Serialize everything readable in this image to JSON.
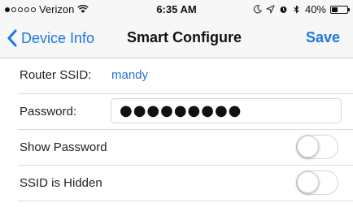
{
  "status_bar": {
    "carrier": "Verizon",
    "time": "6:35 AM",
    "battery_percent": "40%",
    "battery_level": 0.4,
    "icons": [
      "signal-dots",
      "wifi-icon",
      "moon-icon",
      "location-icon",
      "alarm-icon",
      "bluetooth-icon",
      "battery-icon"
    ]
  },
  "nav": {
    "back_label": "Device Info",
    "title": "Smart Configure",
    "save_label": "Save"
  },
  "form": {
    "router_ssid_label": "Router SSID:",
    "router_ssid_value": "mandy",
    "password_label": "Password:",
    "password_value": "●●●●●●●●●",
    "show_password_label": "Show Password",
    "show_password_on": false,
    "ssid_hidden_label": "SSID is Hidden",
    "ssid_hidden_on": false
  },
  "colors": {
    "accent": "#1a78e5",
    "ssid_value": "#2a6fd1",
    "separator": "#dcdce0"
  }
}
